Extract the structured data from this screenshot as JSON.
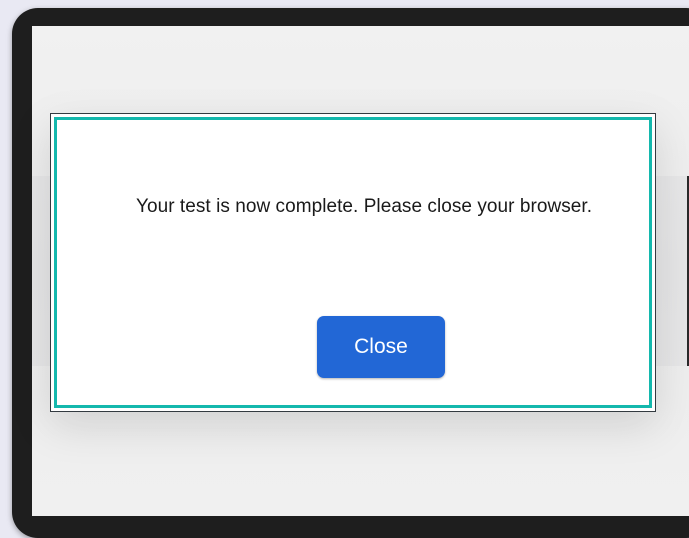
{
  "dialog": {
    "message": "Your test is now complete. Please close your browser.",
    "close_label": "Close"
  },
  "colors": {
    "accent_border": "#14b8ad",
    "button_bg": "#2267d6",
    "button_text": "#ffffff",
    "device_frame": "#1e1e1e"
  }
}
